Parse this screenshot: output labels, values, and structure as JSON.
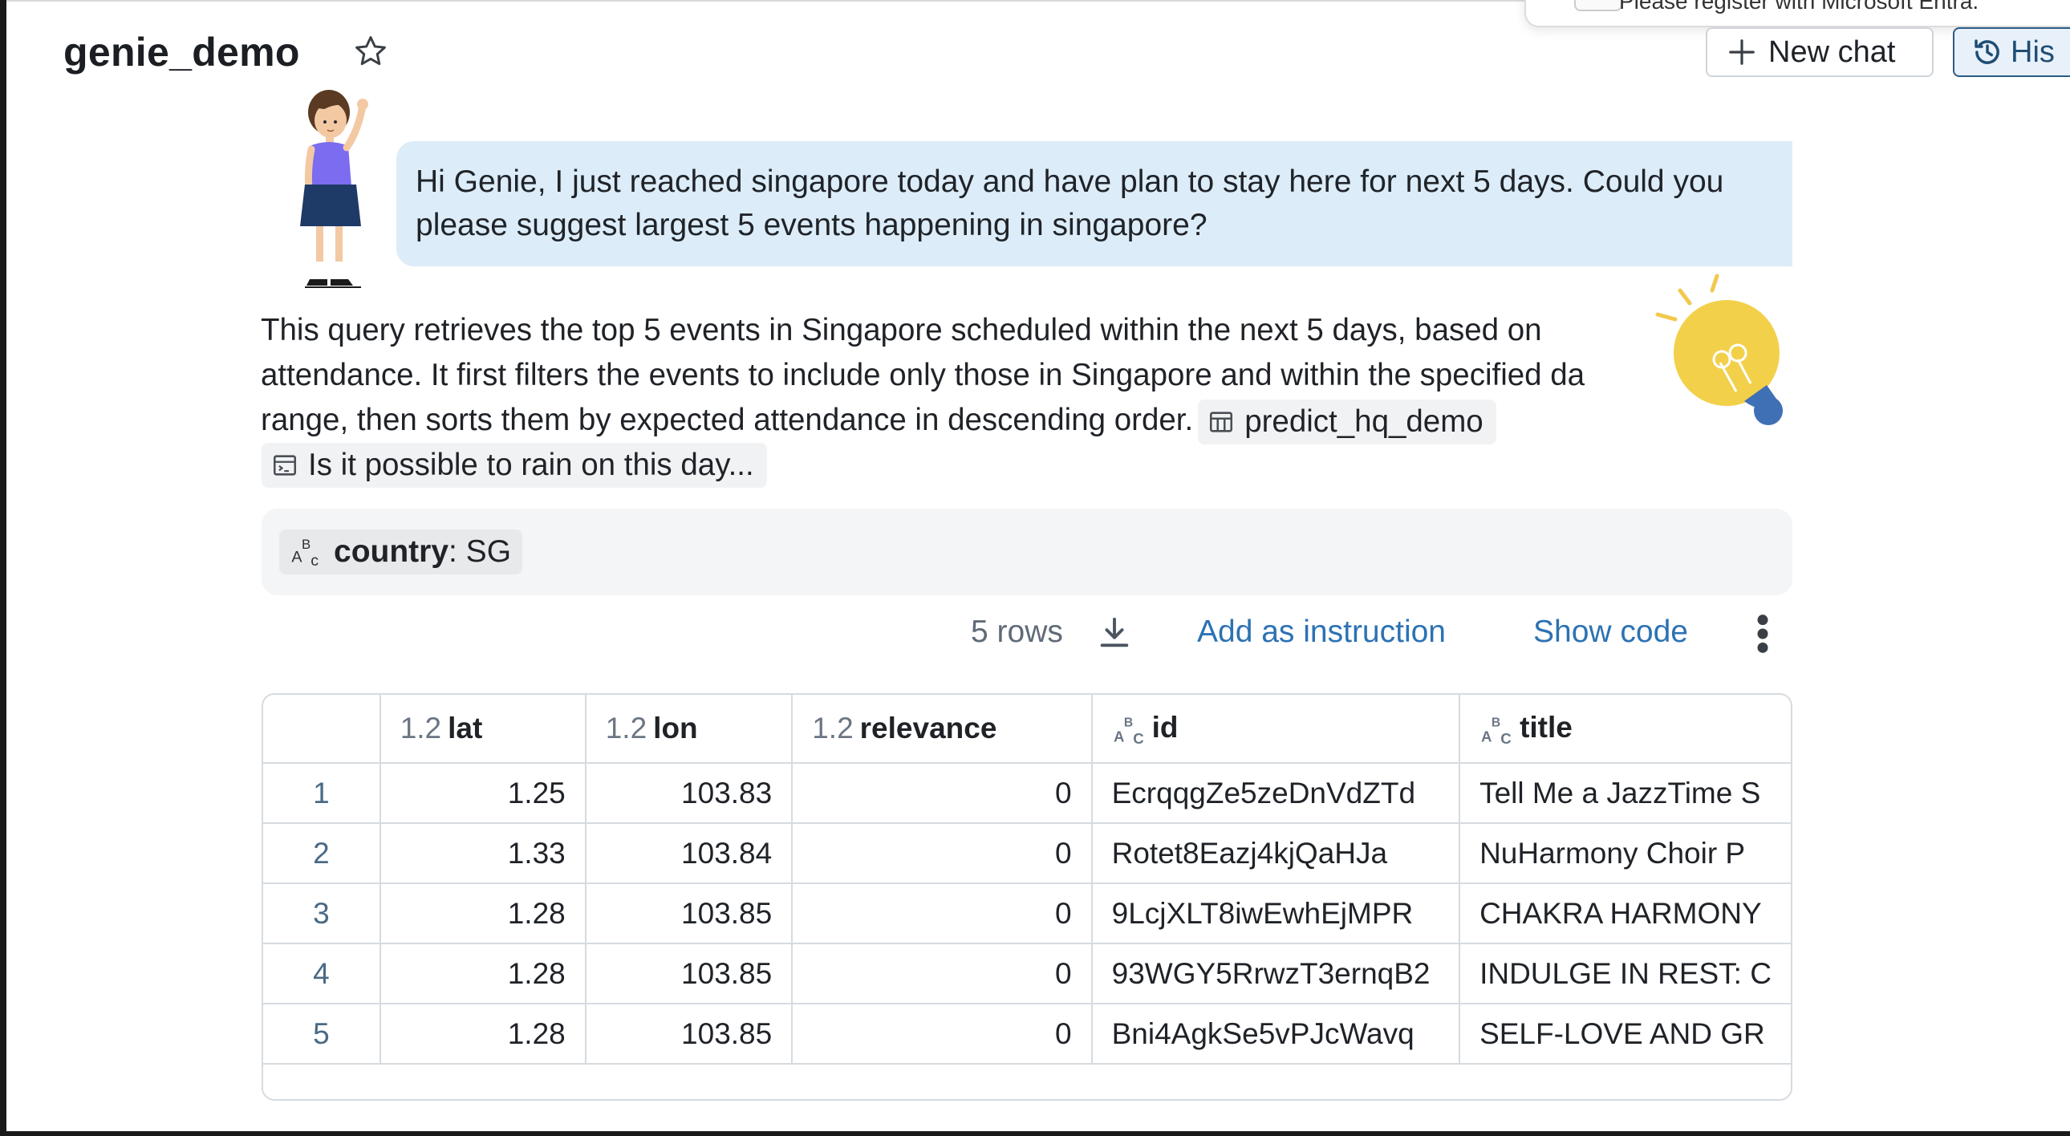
{
  "header": {
    "title": "genie_demo",
    "toast_text": "Please register with Microsoft Entra.",
    "new_chat_label": "New chat",
    "history_label": "His"
  },
  "conversation": {
    "user_message": "Hi Genie, I just reached singapore today and have plan to stay here for next 5 days. Could you please suggest largest 5 events happening in singapore?",
    "answer_text": "This query retrieves the top 5 events in Singapore scheduled within the next 5 days, based on attendance. It first filters the events to include only those in Singapore and within the specified da",
    "answer_text_2": "range, then sorts them by expected attendance in descending order.",
    "table_chip": "predict_hq_demo",
    "followup_chip": "Is it possible to rain on this day..."
  },
  "filter": {
    "type_label": "ABC",
    "key": "country",
    "value": ": SG"
  },
  "toolbar": {
    "rows_label": "5 rows",
    "add_instruction": "Add as instruction",
    "show_code": "Show code"
  },
  "table": {
    "columns": [
      {
        "type": "",
        "name": ""
      },
      {
        "type": "1.2",
        "name": "lat"
      },
      {
        "type": "1.2",
        "name": "lon"
      },
      {
        "type": "1.2",
        "name": "relevance"
      },
      {
        "type": "abc",
        "name": "id"
      },
      {
        "type": "abc",
        "name": "title"
      }
    ],
    "rows": [
      [
        "1",
        "1.25",
        "103.83",
        "0",
        "EcrqqgZe5zeDnVdZTd",
        "Tell Me a JazzTime S"
      ],
      [
        "2",
        "1.33",
        "103.84",
        "0",
        "Rotet8Eazj4kjQaHJa",
        "NuHarmony Choir P"
      ],
      [
        "3",
        "1.28",
        "103.85",
        "0",
        "9LcjXLT8iwEwhEjMPR",
        "CHAKRA HARMONY"
      ],
      [
        "4",
        "1.28",
        "103.85",
        "0",
        "93WGY5RrwzT3ernqB2",
        "INDULGE IN REST: C"
      ],
      [
        "5",
        "1.28",
        "103.85",
        "0",
        "Bni4AgkSe5vPJcWavq",
        "SELF-LOVE AND GR"
      ]
    ]
  },
  "colors": {
    "accent_link": "#2c72b3",
    "bubble_bg": "#dcecf9",
    "history_button_bg": "#e8f1fa"
  }
}
